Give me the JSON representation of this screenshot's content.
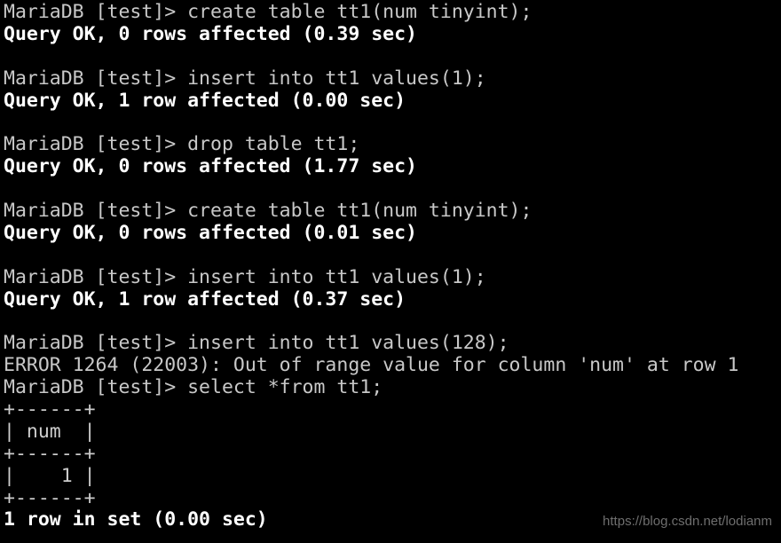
{
  "terminal": {
    "title": "MariaDB client session",
    "background_color": "#000000",
    "foreground_color": "#c8c8c8",
    "bold_color": "#ffffff",
    "prompt": "MariaDB [test]> ",
    "database": "test",
    "columns": 64,
    "rows": 24,
    "lines": [
      {
        "text": "MariaDB [test]> create table tt1(num tinyint);",
        "style": "normal",
        "kind": "prompt-command"
      },
      {
        "text": "Query OK, 0 rows affected (0.39 sec)",
        "style": "bold",
        "kind": "result"
      },
      {
        "text": "",
        "style": "blank",
        "kind": "blank"
      },
      {
        "text": "MariaDB [test]> insert into tt1 values(1);",
        "style": "normal",
        "kind": "prompt-command"
      },
      {
        "text": "Query OK, 1 row affected (0.00 sec)",
        "style": "bold",
        "kind": "result"
      },
      {
        "text": "",
        "style": "blank",
        "kind": "blank"
      },
      {
        "text": "MariaDB [test]> drop table tt1;",
        "style": "normal",
        "kind": "prompt-command"
      },
      {
        "text": "Query OK, 0 rows affected (1.77 sec)",
        "style": "bold",
        "kind": "result"
      },
      {
        "text": "",
        "style": "blank",
        "kind": "blank"
      },
      {
        "text": "MariaDB [test]> create table tt1(num tinyint);",
        "style": "normal",
        "kind": "prompt-command"
      },
      {
        "text": "Query OK, 0 rows affected (0.01 sec)",
        "style": "bold",
        "kind": "result"
      },
      {
        "text": "",
        "style": "blank",
        "kind": "blank"
      },
      {
        "text": "MariaDB [test]> insert into tt1 values(1);",
        "style": "normal",
        "kind": "prompt-command"
      },
      {
        "text": "Query OK, 1 row affected (0.37 sec)",
        "style": "bold",
        "kind": "result"
      },
      {
        "text": "",
        "style": "blank",
        "kind": "blank"
      },
      {
        "text": "MariaDB [test]> insert into tt1 values(128);",
        "style": "normal",
        "kind": "prompt-command"
      },
      {
        "text": "ERROR 1264 (22003): Out of range value for column 'num' at row 1",
        "style": "normal",
        "kind": "error"
      },
      {
        "text": "MariaDB [test]> select *from tt1;",
        "style": "normal",
        "kind": "prompt-command"
      },
      {
        "text": "+------+",
        "style": "table",
        "kind": "table-rule"
      },
      {
        "text": "| num  |",
        "style": "table",
        "kind": "table-header"
      },
      {
        "text": "+------+",
        "style": "table",
        "kind": "table-rule"
      },
      {
        "text": "|    1 |",
        "style": "table",
        "kind": "table-row"
      },
      {
        "text": "+------+",
        "style": "table",
        "kind": "table-rule"
      },
      {
        "text": "1 row in set (0.00 sec)",
        "style": "bold",
        "kind": "result"
      }
    ],
    "commands": [
      "create table tt1(num tinyint);",
      "insert into tt1 values(1);",
      "drop table tt1;",
      "create table tt1(num tinyint);",
      "insert into tt1 values(1);",
      "insert into tt1 values(128);",
      "select *from tt1;"
    ],
    "result_table": {
      "columns": [
        "num"
      ],
      "rows": [
        [
          "1"
        ]
      ],
      "footer": "1 row in set (0.00 sec)"
    },
    "error": {
      "code": "1264",
      "sqlstate": "22003",
      "message": "Out of range value for column 'num' at row 1",
      "full": "ERROR 1264 (22003): Out of range value for column 'num' at row 1"
    }
  },
  "watermark": {
    "text": "https://blog.csdn.net/lodianm",
    "color": "#6e6e6e"
  }
}
